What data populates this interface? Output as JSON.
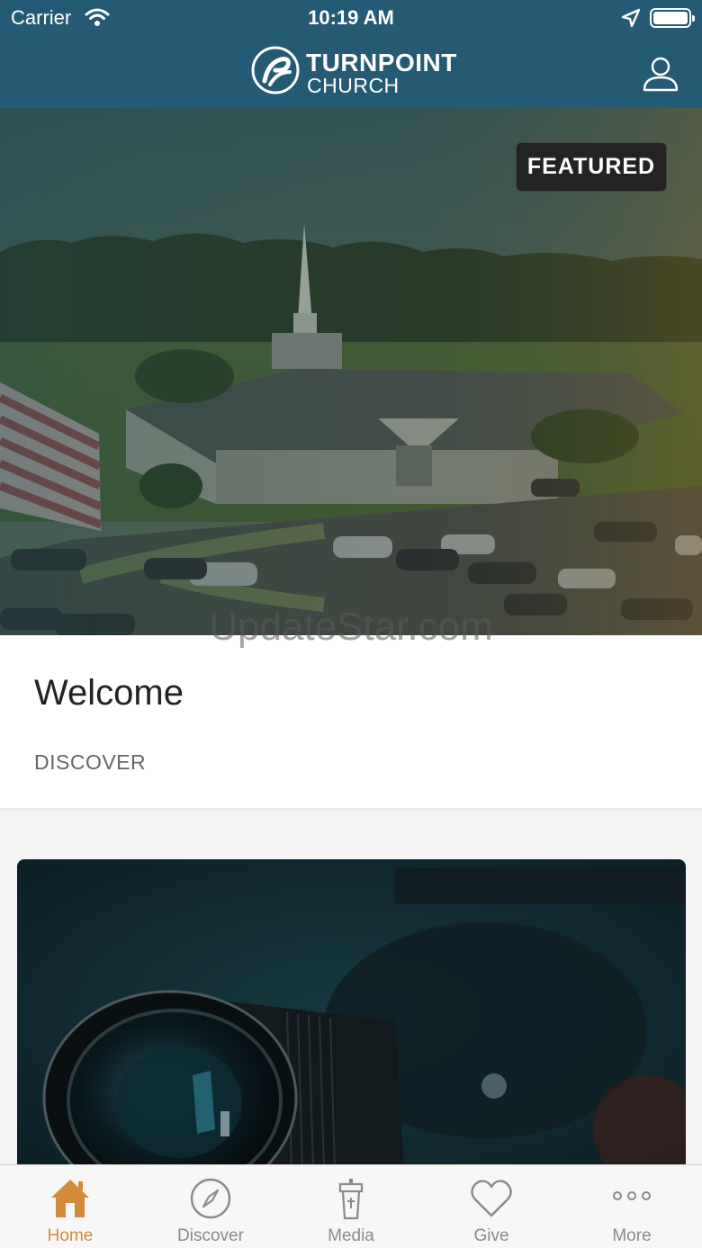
{
  "status_bar": {
    "carrier": "Carrier",
    "time": "10:19 AM"
  },
  "header": {
    "logo_top": "TURNPOINT",
    "logo_bottom": "CHURCH"
  },
  "hero": {
    "badge": "FEATURED"
  },
  "watermark": "UpdateStar.com",
  "welcome": {
    "title": "Welcome",
    "subtitle": "DISCOVER"
  },
  "tabs": [
    {
      "label": "Home",
      "icon": "home-icon",
      "active": true
    },
    {
      "label": "Discover",
      "icon": "compass-icon",
      "active": false
    },
    {
      "label": "Media",
      "icon": "pulpit-icon",
      "active": false
    },
    {
      "label": "Give",
      "icon": "heart-icon",
      "active": false
    },
    {
      "label": "More",
      "icon": "more-dots-icon",
      "active": false
    }
  ],
  "colors": {
    "header": "#245a73",
    "active_tab": "#d58a3a",
    "inactive_tab": "#8a8a8a"
  }
}
